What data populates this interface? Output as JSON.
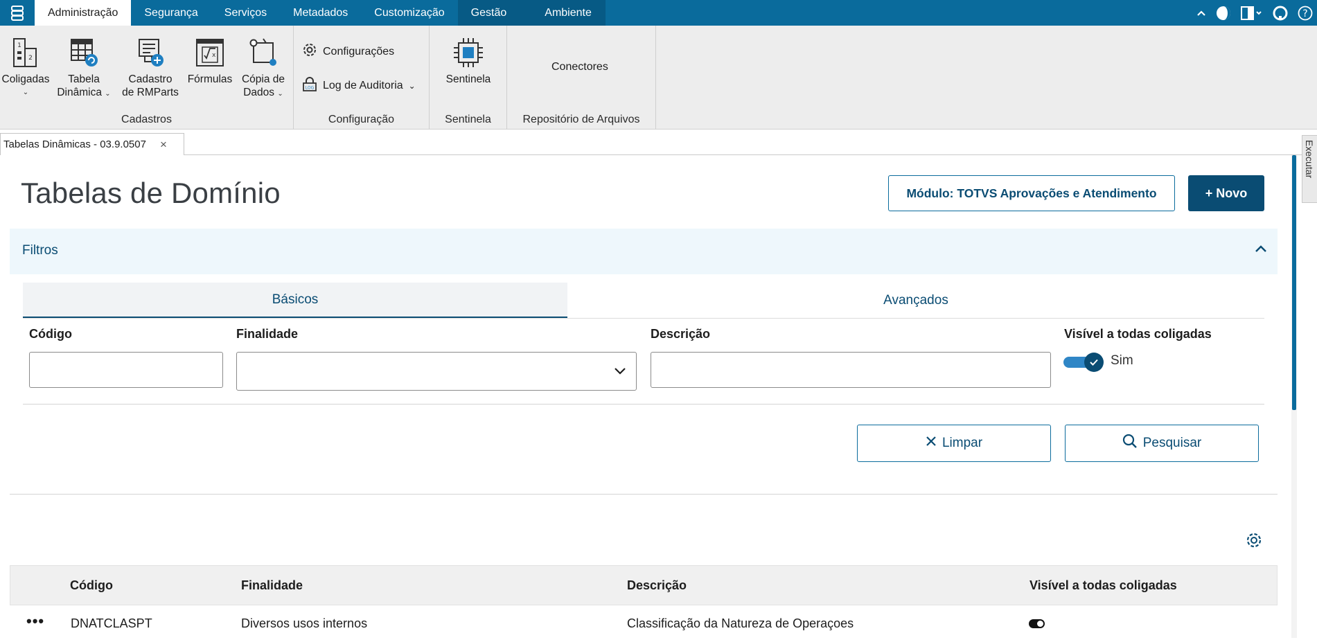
{
  "menubar": {
    "tabs": [
      "Administração",
      "Segurança",
      "Serviços",
      "Metadados",
      "Customização",
      "Gestão",
      "Ambiente"
    ],
    "active_index": 0
  },
  "ribbon": {
    "cadastros": {
      "label": "Cadastros",
      "coligadas": "Coligadas",
      "tabela_dinamica_1": "Tabela",
      "tabela_dinamica_2": "Dinâmica",
      "cadastro_rmparts_1": "Cadastro",
      "cadastro_rmparts_2": "de RMParts",
      "formulas": "Fórmulas",
      "copia_dados_1": "Cópia de",
      "copia_dados_2": "Dados"
    },
    "configuracao": {
      "label": "Configuração",
      "configuracoes": "Configurações",
      "log_auditoria": "Log de Auditoria"
    },
    "sentinela": {
      "label": "Sentinela",
      "button": "Sentinela"
    },
    "repositorio": {
      "label": "Repositório de Arquivos",
      "conectores": "Conectores"
    }
  },
  "doc_tab": {
    "title": "Tabelas Dinâmicas - 03.9.0507",
    "close": "×"
  },
  "side_tab": {
    "label": "Executar"
  },
  "page": {
    "title": "Tabelas de Domínio",
    "module_button": "Módulo: TOTVS Aprovações e Atendimento",
    "new_button": "+ Novo"
  },
  "filters": {
    "header": "Filtros",
    "tabs": {
      "basic": "Básicos",
      "advanced": "Avançados"
    },
    "codigo_label": "Código",
    "codigo_value": "",
    "finalidade_label": "Finalidade",
    "finalidade_value": "",
    "descricao_label": "Descrição",
    "descricao_value": "",
    "visivel_label": "Visível a todas coligadas",
    "visivel_value": "Sim",
    "clear_button": "Limpar",
    "search_button": "Pesquisar"
  },
  "table": {
    "columns": [
      "Código",
      "Finalidade",
      "Descrição",
      "Visível a todas coligadas"
    ],
    "rows": [
      {
        "actions": "•••",
        "codigo": "DNATCLASPT",
        "finalidade": "Diversos usos internos",
        "descricao": "Classificação da Natureza de Operaçoes",
        "visivel": true
      }
    ]
  },
  "colors": {
    "primary": "#0a4c73",
    "menubar": "#0a6b9c",
    "filters_bg": "#eef7fc"
  }
}
